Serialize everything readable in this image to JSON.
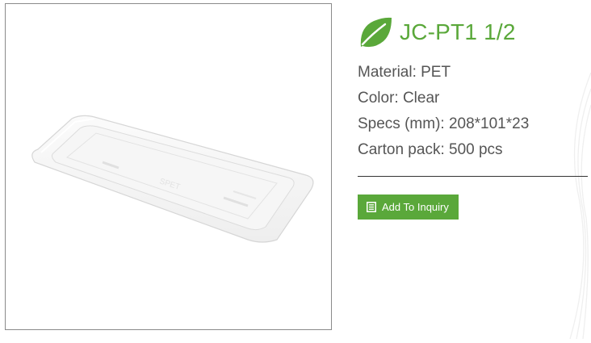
{
  "product": {
    "title": "JC-PT1 1/2",
    "specs": [
      "Material: PET",
      "Color: Clear",
      "Specs (mm): 208*101*23",
      "Carton pack: 500 pcs"
    ],
    "inquiry_button_label": "Add To Inquiry",
    "icons": {
      "title": "leaf-icon",
      "button": "list-icon"
    },
    "image_alt": "clear PET tray"
  },
  "colors": {
    "accent": "#5aa83a",
    "text": "#555555",
    "divider": "#333333",
    "frame_border": "#8a8a8a"
  }
}
